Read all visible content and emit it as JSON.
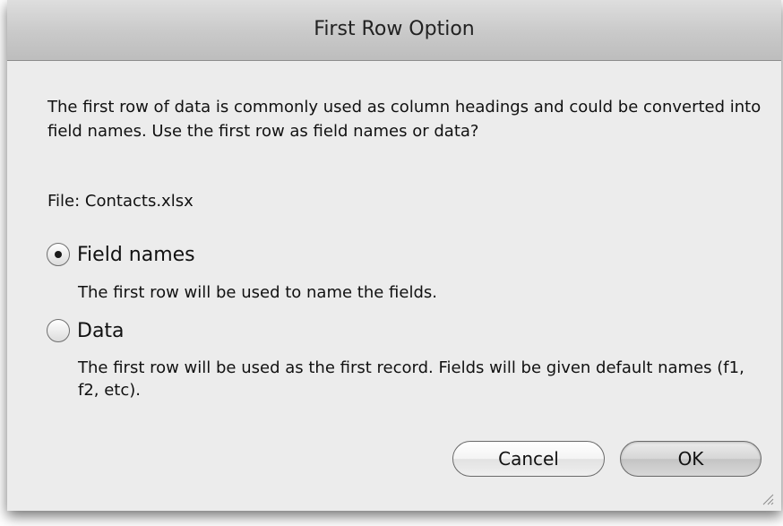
{
  "dialog": {
    "title": "First Row Option",
    "message": "The first row of data is commonly used as column headings and could be converted into field names. Use the first row as field names or data?",
    "file_line": "File: Contacts.xlsx"
  },
  "options": {
    "field_names": {
      "label": "Field names",
      "description": "The first row will be used to name the fields.",
      "selected": true
    },
    "data": {
      "label": "Data",
      "description": "The first row will be used as the first record. Fields will be given default names (f1, f2, etc).",
      "selected": false
    }
  },
  "buttons": {
    "cancel_label": "Cancel",
    "ok_label": "OK"
  },
  "icons": {
    "resize": "resize-grip-icon"
  }
}
